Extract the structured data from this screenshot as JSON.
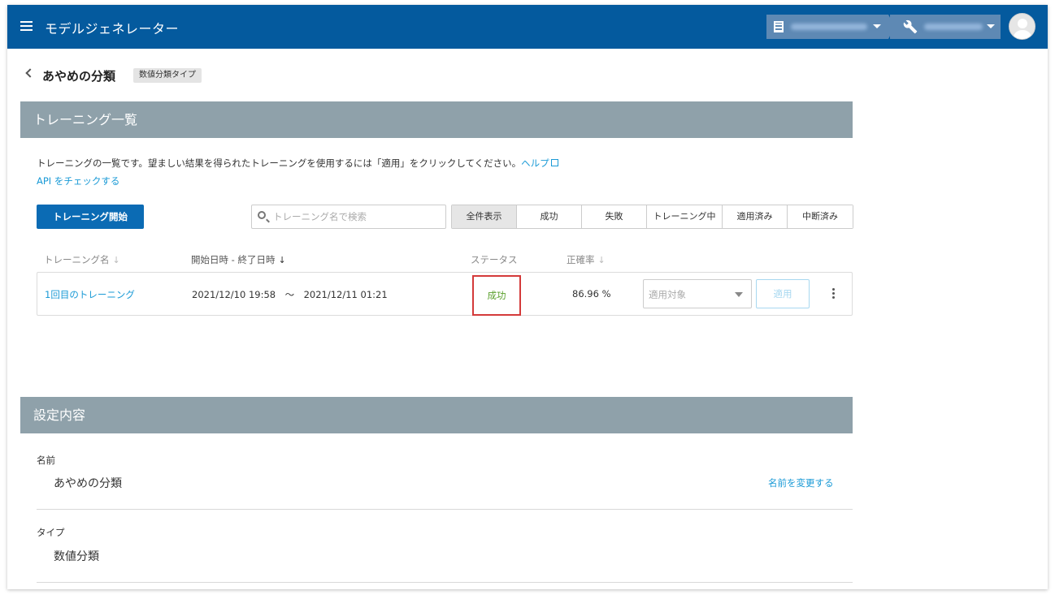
{
  "app": {
    "title": "モデルジェネレーター"
  },
  "page": {
    "title": "あやめの分類",
    "type_badge": "数値分類タイプ"
  },
  "training": {
    "section_title": "トレーニング一覧",
    "description": "トレーニングの一覧です。望ましい結果を得られたトレーニングを使用するには「適用」をクリックしてください。",
    "help_link": "ヘルプ",
    "api_link": "API をチェックする",
    "start_button": "トレーニング開始",
    "search_placeholder": "トレーニング名で検索",
    "filters": [
      "全件表示",
      "成功",
      "失敗",
      "トレーニング中",
      "適用済み",
      "中断済み"
    ],
    "active_filter": "全件表示",
    "columns": {
      "name": "トレーニング名",
      "datetime": "開始日時 - 終了日時",
      "status": "ステータス",
      "accuracy": "正確率"
    },
    "rows": [
      {
        "name": "1回目のトレーニング",
        "datetime": "2021/12/10 19:58　〜　2021/12/11 01:21",
        "status": "成功",
        "accuracy": "86.96 %",
        "select_placeholder": "適用対象",
        "apply_label": "適用"
      }
    ]
  },
  "settings": {
    "section_title": "設定内容",
    "name_label": "名前",
    "name_value": "あやめの分類",
    "rename_link": "名前を変更する",
    "type_label": "タイプ",
    "type_value": "数値分類"
  },
  "colors": {
    "topbar": "#045a9e",
    "section_header": "#8fa1aa",
    "primary_button": "#0b6bb4",
    "link": "#1a9ad6",
    "success": "#5aa02c",
    "highlight_border": "#d43a3a"
  }
}
